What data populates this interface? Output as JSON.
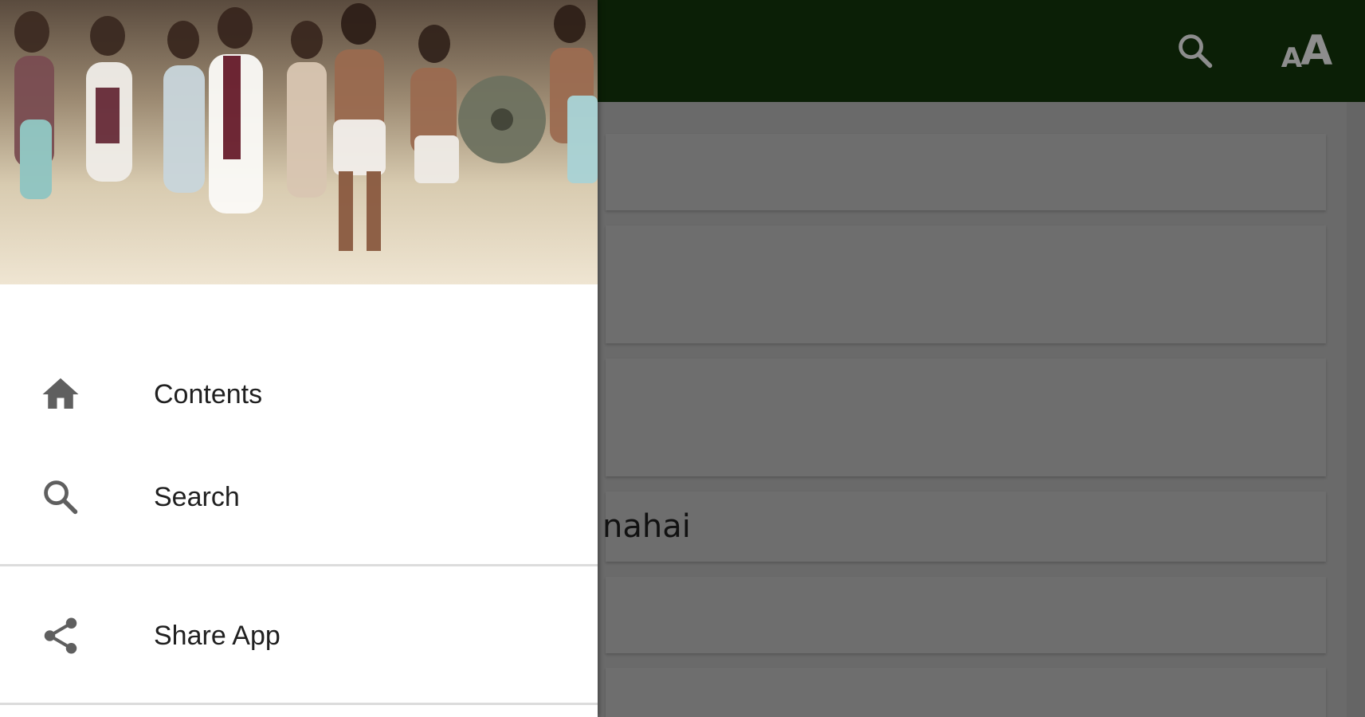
{
  "menu": {
    "items": [
      {
        "label": "Contents",
        "icon": "home-icon"
      },
      {
        "label": "Search",
        "icon": "search-icon"
      },
      {
        "label": "Share App",
        "icon": "share-icon"
      }
    ]
  },
  "background": {
    "visible_card_text": "nahai",
    "appbar_icons": [
      "search-icon",
      "text-size-icon"
    ]
  },
  "text_size_icon": {
    "small": "A",
    "big": "A"
  },
  "colors": {
    "appbar": "#0b1f06",
    "scrim": "#6b6b6b",
    "drawer": "#ffffff",
    "menu_text": "#202020",
    "icon": "#5f5f5f"
  }
}
